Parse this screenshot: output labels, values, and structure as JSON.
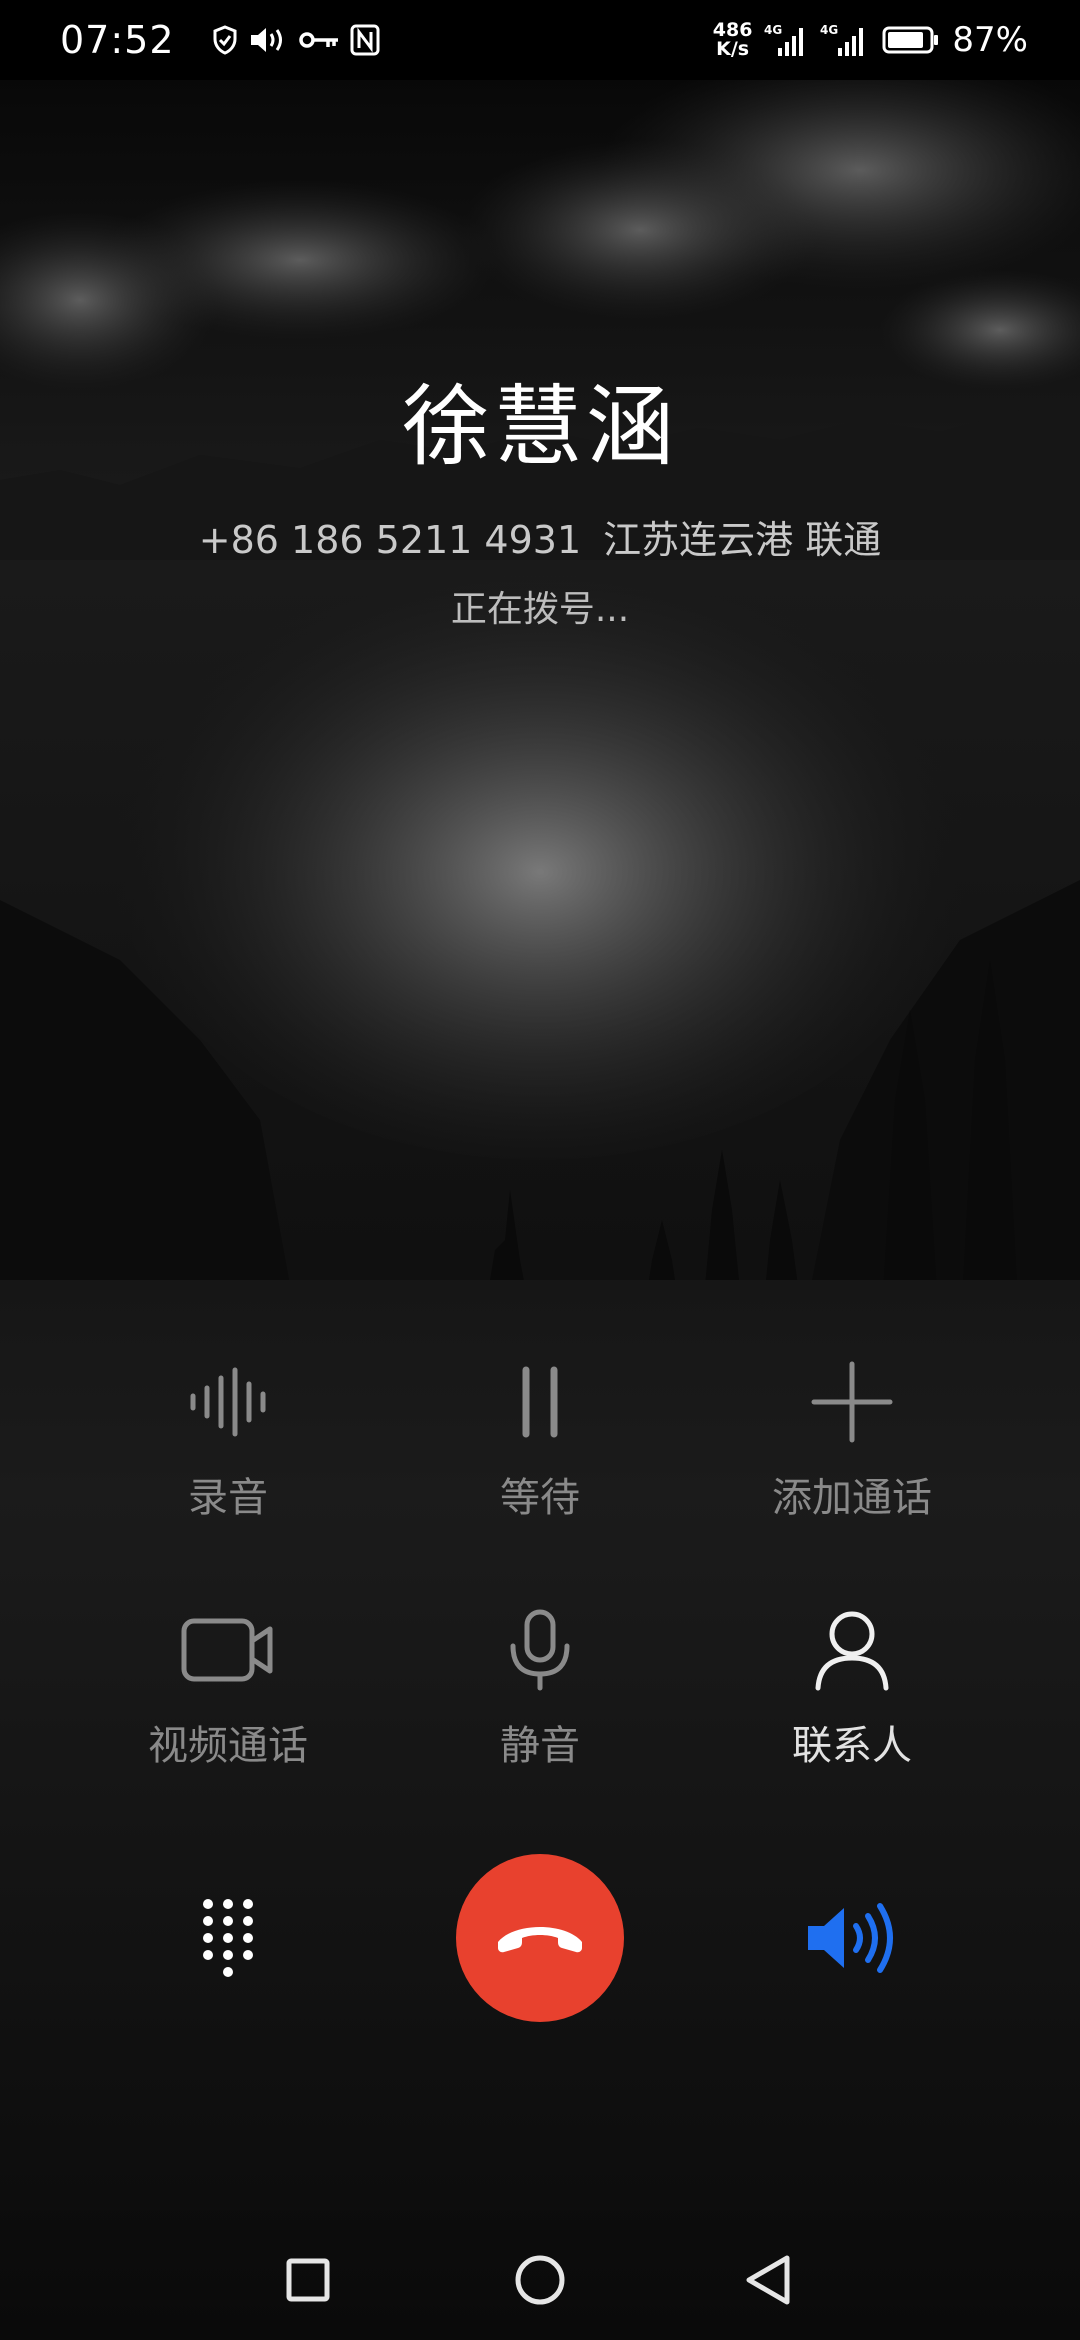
{
  "status_bar": {
    "time": "07:52",
    "net_speed_value": "486",
    "net_speed_unit": "K/s",
    "sim1_type": "4G",
    "sim2_type": "4G",
    "battery_percent": "87%",
    "battery_level": 0.87,
    "icons": [
      "shield-icon",
      "volume-icon",
      "key-icon",
      "nfc-icon",
      "signal-icon",
      "battery-icon"
    ]
  },
  "caller": {
    "name": "徐慧涵",
    "number": "+86 186 5211 4931",
    "location_carrier": "江苏连云港 联通",
    "status": "正在拨号..."
  },
  "actions": [
    {
      "id": "record",
      "label": "录音",
      "icon": "waveform-icon",
      "enabled": false
    },
    {
      "id": "hold",
      "label": "等待",
      "icon": "pause-icon",
      "enabled": false
    },
    {
      "id": "add-call",
      "label": "添加通话",
      "icon": "plus-icon",
      "enabled": false
    },
    {
      "id": "video-call",
      "label": "视频通话",
      "icon": "video-camera-icon",
      "enabled": false
    },
    {
      "id": "mute",
      "label": "静音",
      "icon": "microphone-icon",
      "enabled": false
    },
    {
      "id": "contacts",
      "label": "联系人",
      "icon": "person-icon",
      "enabled": true
    }
  ],
  "controls": {
    "dialpad_icon": "dialpad-icon",
    "end_call_icon": "hang-up-icon",
    "speaker_icon": "speaker-icon",
    "speaker_active": true
  },
  "colors": {
    "end_call": "#e8412e",
    "speaker_active": "#1f6ff0",
    "disabled_label": "#8a8a8a",
    "enabled_label": "#e2e2e2"
  },
  "nav_bar": {
    "icons": [
      "square-recents-icon",
      "circle-home-icon",
      "triangle-back-icon"
    ]
  }
}
